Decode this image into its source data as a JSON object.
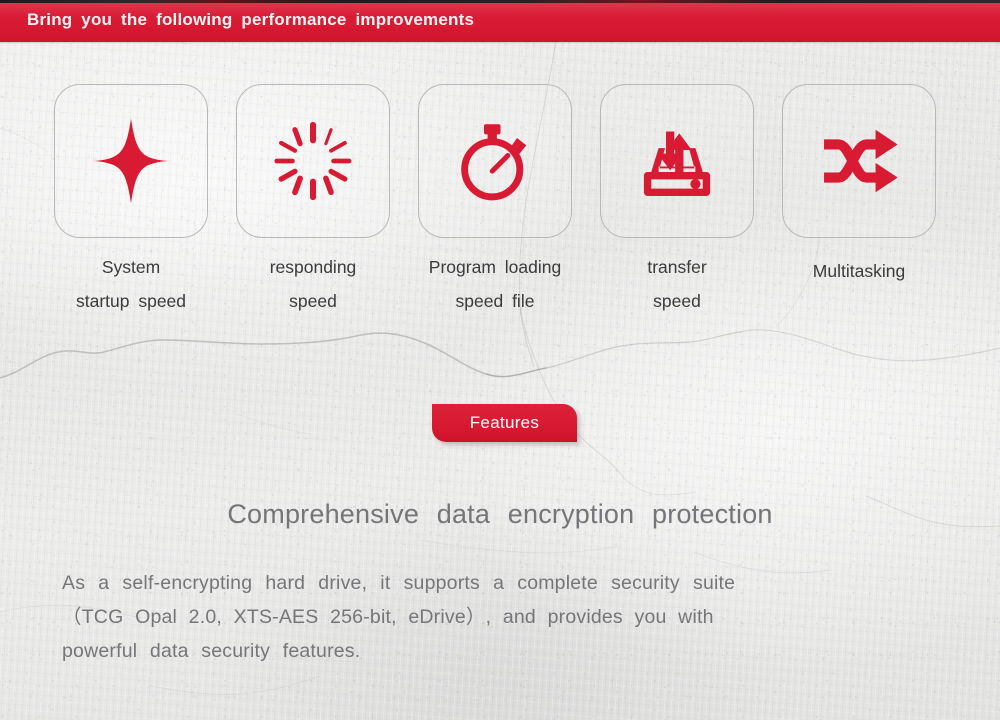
{
  "header": {
    "title": "Bring you the following performance improvements"
  },
  "features": [
    {
      "icon": "sparkle-star-icon",
      "label_line1": "System",
      "label_line2": "startup speed"
    },
    {
      "icon": "loading-spinner-icon",
      "label_line1": "responding",
      "label_line2": "speed"
    },
    {
      "icon": "stopwatch-icon",
      "label_line1": "Program loading",
      "label_line2": "speed file"
    },
    {
      "icon": "drive-transfer-icon",
      "label_line1": "transfer",
      "label_line2": "speed"
    },
    {
      "icon": "shuffle-arrows-icon",
      "label_line1": "Multitasking",
      "label_line2": ""
    }
  ],
  "badge": {
    "label": "Features"
  },
  "section": {
    "heading": "Comprehensive data encryption protection",
    "paragraph_line1": "As a self-encrypting hard drive, it supports a complete security suite",
    "paragraph_line2": "（TCG Opal 2.0, XTS-AES 256-bit, eDrive）, and provides you with",
    "paragraph_line3": "powerful data security features."
  },
  "colors": {
    "brand_red": "#d81a33",
    "header_text": "#fdf4f5",
    "body_text": "#76767a",
    "heading_text": "#757579",
    "label_text": "#3b3b3b",
    "box_border": "#b8b8b8",
    "background": "#e8e8e7"
  }
}
